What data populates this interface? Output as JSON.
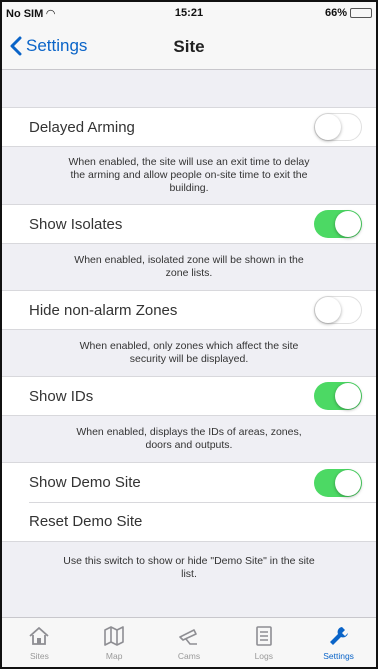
{
  "status": {
    "carrier": "No SIM",
    "time": "15:21",
    "battery": "66%",
    "battery_level": 0.66
  },
  "nav": {
    "back_label": "Settings",
    "title": "Site"
  },
  "settings": {
    "delayed_arming": {
      "label": "Delayed Arming",
      "enabled": false,
      "desc": "When enabled, the site will use an exit time to delay the arming and allow people on-site time to exit the building."
    },
    "show_isolates": {
      "label": "Show Isolates",
      "enabled": true,
      "desc": "When enabled, isolated zone will be shown in the zone lists."
    },
    "hide_non_alarm": {
      "label": "Hide non-alarm Zones",
      "enabled": false,
      "desc": "When enabled, only zones which affect the site security will be displayed."
    },
    "show_ids": {
      "label": "Show IDs",
      "enabled": true,
      "desc": "When enabled, displays the IDs of areas, zones, doors and outputs."
    },
    "show_demo": {
      "label": "Show Demo Site",
      "enabled": true
    },
    "reset_demo": {
      "label": "Reset Demo Site"
    },
    "demo_desc": "Use this switch to show or hide \"Demo Site\" in the site list."
  },
  "tabs": [
    {
      "label": "Sites",
      "icon": "sites-icon",
      "active": false
    },
    {
      "label": "Map",
      "icon": "map-icon",
      "active": false
    },
    {
      "label": "Cams",
      "icon": "cams-icon",
      "active": false
    },
    {
      "label": "Logs",
      "icon": "logs-icon",
      "active": false
    },
    {
      "label": "Settings",
      "icon": "wrench-icon",
      "active": true
    }
  ],
  "colors": {
    "accent": "#0a64c8",
    "toggle_on": "#4cd964",
    "background": "#efeff4"
  }
}
